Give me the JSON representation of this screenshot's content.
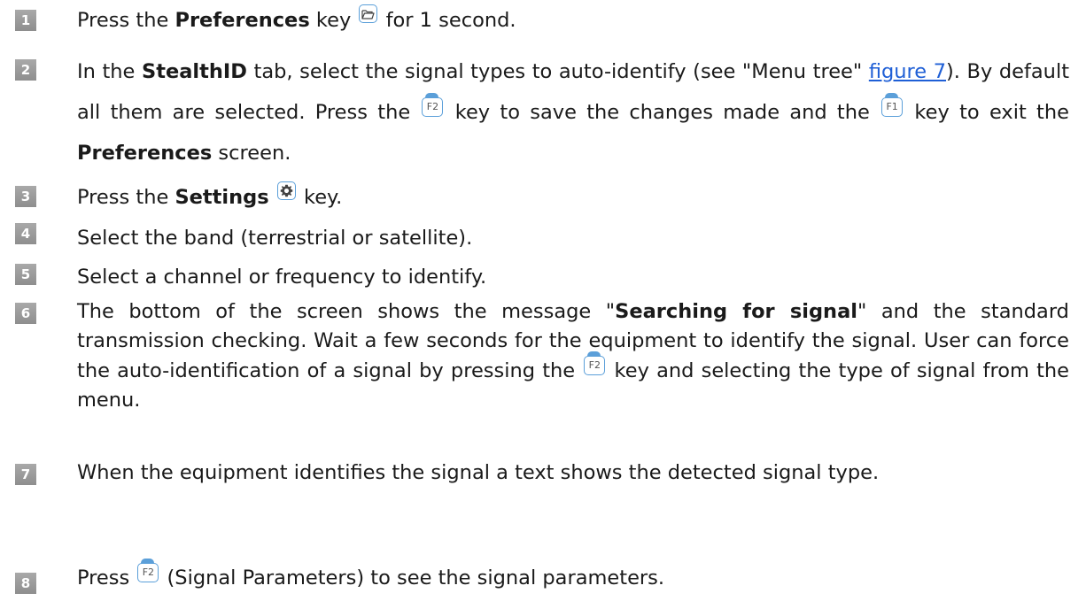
{
  "accent_color": "#5b9fd9",
  "link_color": "#1f5fd6",
  "badge_color": "#9b9b9b",
  "steps": [
    {
      "number": "1"
    },
    {
      "number": "2"
    },
    {
      "number": "3"
    },
    {
      "number": "4"
    },
    {
      "number": "5"
    },
    {
      "number": "6"
    },
    {
      "number": "7"
    },
    {
      "number": "8"
    }
  ],
  "text": {
    "press_the": "Press the",
    "press": "Press",
    "key": "key",
    "preferences": "Preferences",
    "for_1_second": "for 1 second.",
    "s2_in_the": "In the",
    "stealthid": "StealthID",
    "s2_tab_text": "tab, select the signal types to auto-identify (see \"Menu tree\"",
    "figure_7": "figure 7",
    "s2_after_link": "). By default all them are selected. Press the",
    "s2_save": "key to save the changes made and the",
    "s2_exit": "key to exit the",
    "screen": "screen.",
    "settings": "Settings",
    "key_period": "key.",
    "s4": "Select the band (terrestrial or satellite).",
    "s5": "Select a channel or frequency to identify.",
    "s6_a": "The bottom of the screen shows the message \"",
    "searching": "Searching for signal",
    "s6_b": "\" and the standard transmission checking. Wait a few seconds for the equipment to identify the signal. User can force the auto-identification of a signal by pressing the",
    "s6_c": "key and selecting the type of signal from the menu.",
    "s7": "When the equipment identifies the signal a text shows the detected signal type.",
    "s8": "(Signal Parameters) to see the signal parameters."
  },
  "keys": {
    "f1": "F1",
    "f2": "F2",
    "preferences_icon": "folder-icon",
    "settings_icon": "gear-icon"
  }
}
